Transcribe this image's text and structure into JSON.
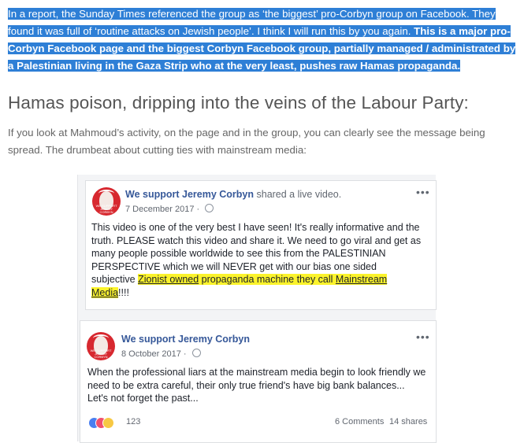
{
  "article": {
    "selected_part1": "In a report, the Sunday Times referenced the group as ‘the biggest’ pro-Corbyn group on Facebook. They found it was full of ‘routine attacks on Jewish people’. I think I will run this by you again. ",
    "selected_bold": "This is a major pro-Corbyn Facebook page and the biggest Corbyn Facebook group, partially managed / administrated by a Palestinian living in the Gaza Strip who at the very least, pushes raw Hamas propaganda.",
    "heading": "Hamas poison, dripping into the veins of the Labour Party:",
    "paragraph": "If you look at Mahmoud’s activity, on the page and in the group, you can clearly see the message being spread. The drumbeat about cutting ties with mainstream media:"
  },
  "post1": {
    "author": "We support Jeremy Corbyn",
    "action": " shared a live video.",
    "date": "7 December 2017 · ",
    "more": "•••",
    "text_plain": "This video is one of the very best I have seen! It's really informative and the truth. PLEASE watch this video and share it. We need to go viral and get as many people possible worldwide to see this from the PALESTINIAN PERSPECTIVE which we will NEVER get with our bias one sided subjective ",
    "text_link": "Zionist owned",
    "text_mid": " propaganda machine they call ",
    "text_link2": "Mainstream Media",
    "text_end": "!!!!"
  },
  "post2": {
    "author": "We support Jeremy Corbyn",
    "date": "8 October 2017 · ",
    "more": "•••",
    "text": "When the professional liars at the mainstream media begin to look friendly we need to be extra careful, their only true friend's have big bank balances... Let's not forget the past...",
    "reaction_count": "123",
    "comments": "6 Comments",
    "shares": "14 shares"
  },
  "colors": {
    "selection": "#2e7fd6",
    "highlight": "#fbf32b",
    "fb_link": "#365899"
  },
  "icons": [
    "globe-icon",
    "more-options-icon",
    "like-reaction-icon",
    "love-reaction-icon",
    "haha-reaction-icon"
  ]
}
